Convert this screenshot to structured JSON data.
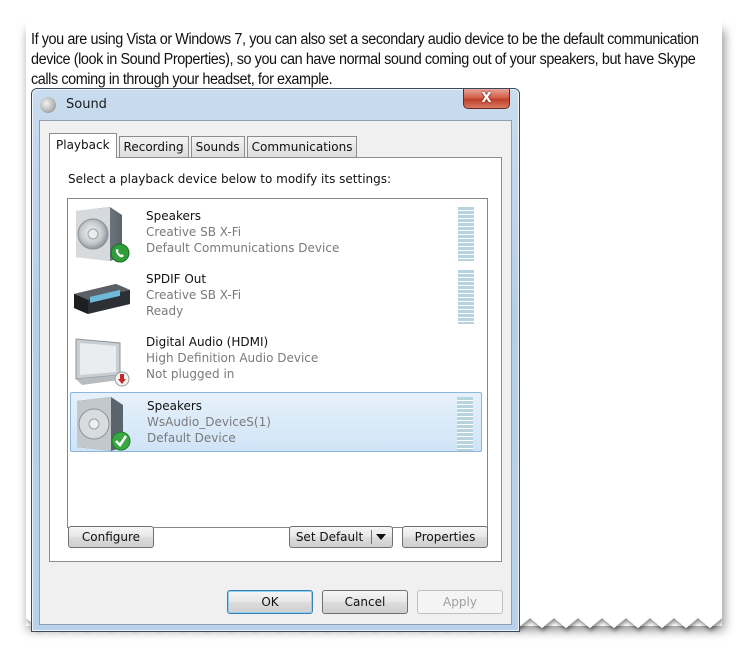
{
  "article": {
    "intro_text": "If you are using Vista or Windows 7, you can also set a secondary audio device to be the default communication device (look in Sound Properties), so you can have normal sound coming out of your speakers, but have Skype calls coming in through your headset, for example."
  },
  "dialog": {
    "title": "Sound",
    "app_icon": "sound-speaker-icon",
    "close_glyph": "X",
    "tabs": [
      {
        "label": "Playback",
        "active": true
      },
      {
        "label": "Recording",
        "active": false
      },
      {
        "label": "Sounds",
        "active": false
      },
      {
        "label": "Communications",
        "active": false
      }
    ],
    "instruction": "Select a playback device below to modify its settings:",
    "devices": [
      {
        "name": "Speakers",
        "driver": "Creative SB X-Fi",
        "status": "Default Communications Device",
        "icon": "speaker-icon",
        "badge": "phone-badge-icon",
        "selected": false,
        "has_meter": true
      },
      {
        "name": "SPDIF Out",
        "driver": "Creative SB X-Fi",
        "status": "Ready",
        "icon": "spdif-device-icon",
        "badge": "",
        "selected": false,
        "has_meter": true
      },
      {
        "name": "Digital Audio (HDMI)",
        "driver": "High Definition Audio Device",
        "status": "Not plugged in",
        "icon": "monitor-icon",
        "badge": "unplugged-badge-icon",
        "selected": false,
        "has_meter": false
      },
      {
        "name": "Speakers",
        "driver": "WsAudio_DeviceS(1)",
        "status": "Default Device",
        "icon": "speaker-icon",
        "badge": "checkmark-badge-icon",
        "selected": true,
        "has_meter": true
      }
    ],
    "buttons": {
      "configure": "Configure",
      "set_default": "Set Default",
      "properties": "Properties",
      "ok": "OK",
      "cancel": "Cancel",
      "apply": "Apply"
    },
    "colors": {
      "selection": "#d0e4f7",
      "close_button": "#c0402a",
      "meter": "#b7d3dd"
    }
  }
}
